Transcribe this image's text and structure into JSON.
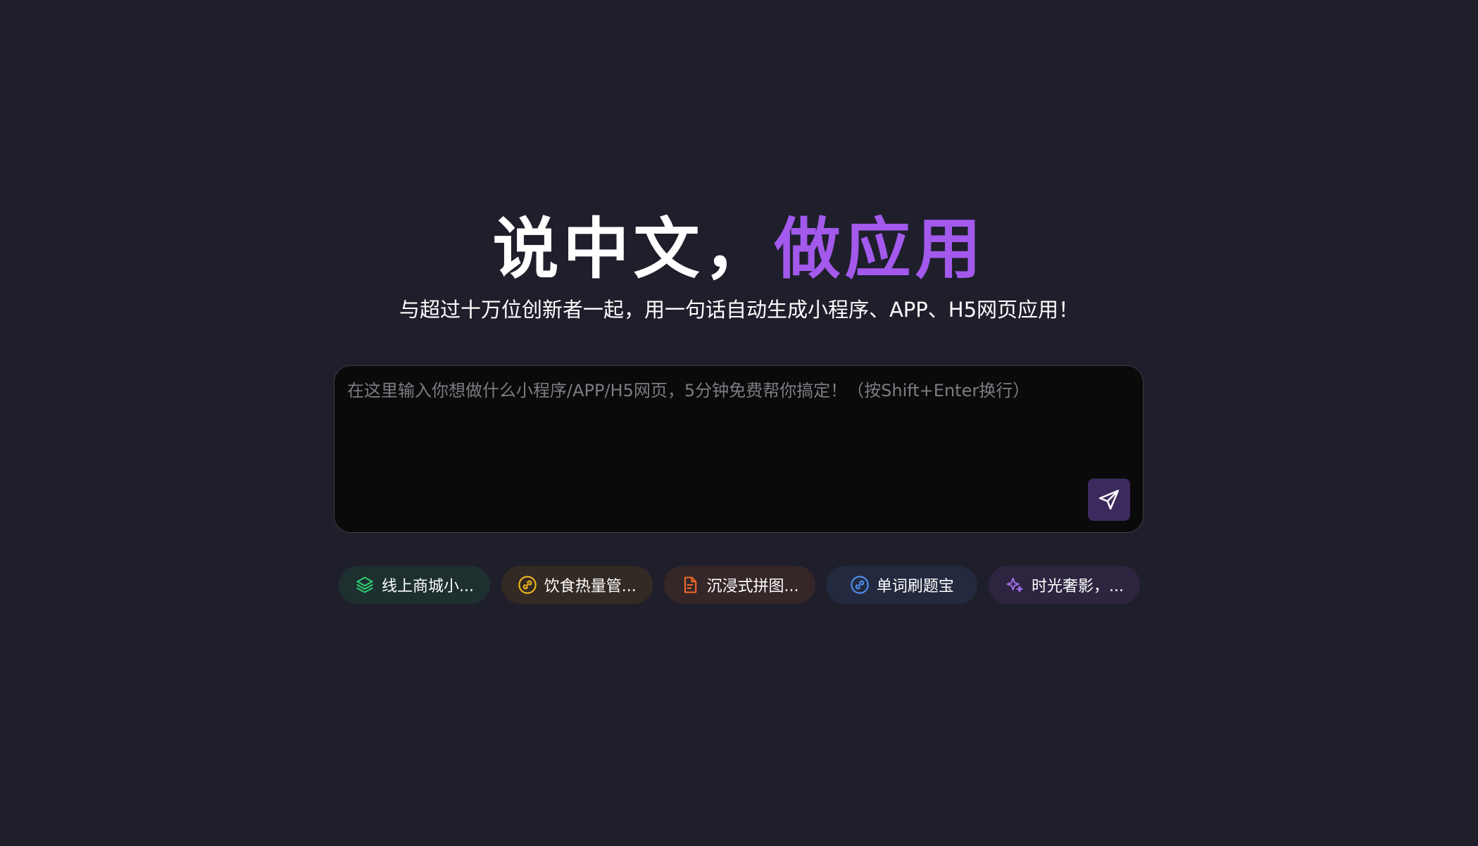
{
  "hero": {
    "title_part1": "说中文，",
    "title_part2": "做应用",
    "subtitle": "与超过十万位创新者一起，用一句话自动生成小程序、APP、H5网页应用！"
  },
  "prompt": {
    "placeholder": "在这里输入你想做什么小程序/APP/H5网页，5分钟免费帮你搞定！（按Shift+Enter换行）",
    "value": ""
  },
  "suggestions": [
    {
      "label": "线上商城小...",
      "icon": "layers-icon",
      "color": "#2ecc71"
    },
    {
      "label": "饮食热量管...",
      "icon": "link-icon",
      "color": "#f1b81c"
    },
    {
      "label": "沉浸式拼图...",
      "icon": "document-icon",
      "color": "#f06a2a"
    },
    {
      "label": "单词刷题宝",
      "icon": "link-icon",
      "color": "#4d8ef0"
    },
    {
      "label": "时光奢影，...",
      "icon": "sparkles-icon",
      "color": "#a86ef0"
    }
  ],
  "colors": {
    "background": "#1f1f2b",
    "accent": "#a259ec",
    "send_button": "#3c2a5e"
  }
}
